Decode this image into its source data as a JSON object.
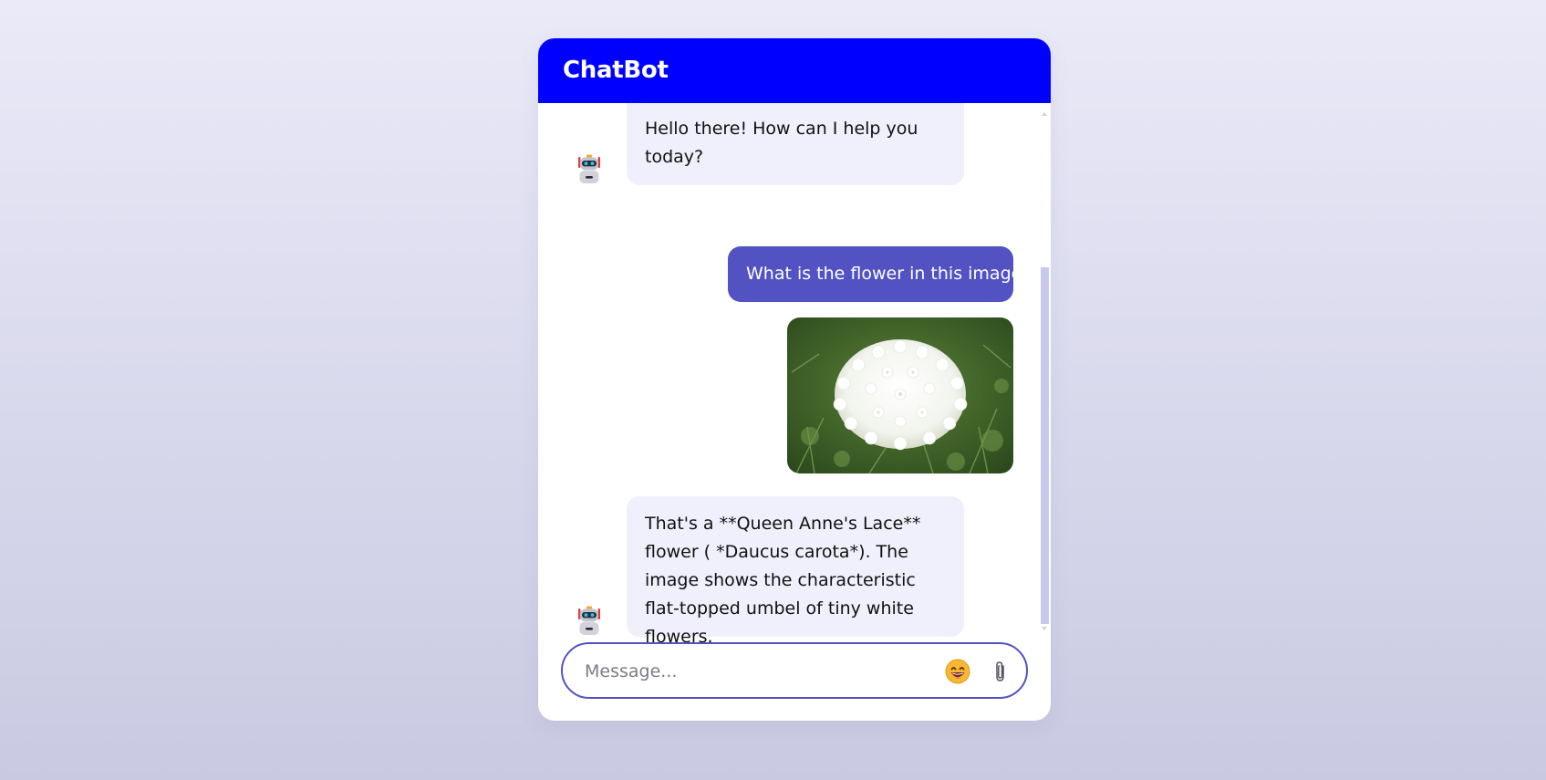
{
  "header": {
    "title": "ChatBot"
  },
  "messages": [
    {
      "role": "bot",
      "text": "Hello there! How can I help you today?"
    },
    {
      "role": "user",
      "text": "What is the flower in this image"
    },
    {
      "role": "user-image",
      "image": "white-flower-photo"
    },
    {
      "role": "bot",
      "text": "That's a **Queen Anne's Lace** flower ( *Daucus carota*). The image shows the characteristic flat-topped umbel of tiny white flowers."
    }
  ],
  "footer": {
    "placeholder": "Message...",
    "emoji_icon": "smiley-face-icon",
    "attach_icon": "paperclip-icon"
  },
  "colors": {
    "header": "#0000ff",
    "user_bubble": "#5352c2",
    "bot_bubble": "#f0f0fc",
    "input_border": "#5352c2",
    "scrollbar_thumb": "#c9c9ee"
  }
}
